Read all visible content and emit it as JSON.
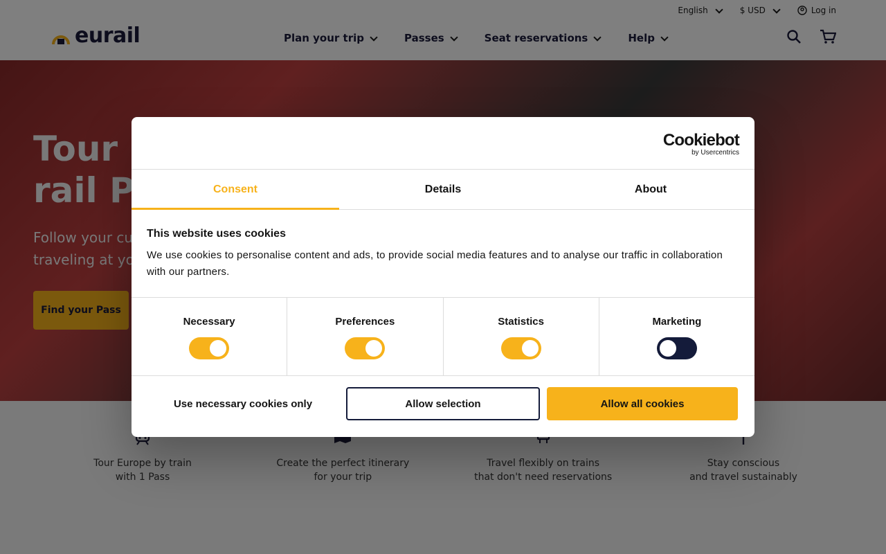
{
  "header": {
    "logo_text": "eurail",
    "language": "English",
    "currency": "$ USD",
    "login": "Log in",
    "nav": [
      {
        "label": "Plan your trip"
      },
      {
        "label": "Passes"
      },
      {
        "label": "Seat reservations"
      },
      {
        "label": "Help"
      }
    ]
  },
  "hero": {
    "title_line1": "Tour E",
    "title_line2": "rail Pa",
    "sub_line1": "Follow your cu",
    "sub_line2": "traveling at yo",
    "cta": "Find your Pass"
  },
  "features": [
    {
      "line1": "Tour Europe by train",
      "line2": "with 1 Pass",
      "icon": "train-icon"
    },
    {
      "line1": "Create the perfect itinerary",
      "line2": "for your trip",
      "icon": "map-icon"
    },
    {
      "line1": "Travel flexibly on trains",
      "line2": "that don't need reservations",
      "icon": "seat-icon"
    },
    {
      "line1": "Stay conscious",
      "line2": "and travel sustainably",
      "icon": "sprout-icon"
    }
  ],
  "dialog": {
    "brand": "Cookiebot",
    "brand_sub": "by Usercentrics",
    "tabs": [
      {
        "label": "Consent"
      },
      {
        "label": "Details"
      },
      {
        "label": "About"
      }
    ],
    "heading": "This website uses cookies",
    "text": "We use cookies to personalise content and ads, to provide social media features and to analyse our traffic in collaboration with our partners.",
    "toggles": [
      {
        "label": "Necessary",
        "on": true
      },
      {
        "label": "Preferences",
        "on": true
      },
      {
        "label": "Statistics",
        "on": true
      },
      {
        "label": "Marketing",
        "on": false
      }
    ],
    "buttons": {
      "necessary_only": "Use necessary cookies only",
      "allow_selection": "Allow selection",
      "allow_all": "Allow all cookies"
    }
  },
  "colors": {
    "accent": "#f7b21b",
    "navy": "#141b3a"
  }
}
